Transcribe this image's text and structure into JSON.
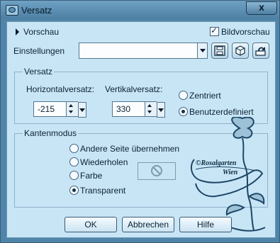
{
  "window": {
    "title": "Versatz",
    "close_glyph": "x"
  },
  "preview": {
    "label": "Vorschau",
    "image_preview_label": "Bildvorschau",
    "image_preview_checked": true
  },
  "settings": {
    "label": "Einstellungen",
    "value": ""
  },
  "offset_group": {
    "title": "Versatz",
    "horizontal_label": "Horizontalversatz:",
    "horizontal_value": "-215",
    "vertical_label": "Vertikalversatz:",
    "vertical_value": "330",
    "options": [
      {
        "label": "Zentriert",
        "selected": false
      },
      {
        "label": "Benutzerdefiniert",
        "selected": true
      }
    ]
  },
  "edge_group": {
    "title": "Kantenmodus",
    "options": [
      {
        "label": "Andere Seite übernehmen",
        "selected": false
      },
      {
        "label": "Wiederholen",
        "selected": false
      },
      {
        "label": "Farbe",
        "selected": false
      },
      {
        "label": "Transparent",
        "selected": true
      }
    ]
  },
  "buttons": {
    "ok": "OK",
    "cancel": "Abbrechen",
    "help": "Hilfe"
  },
  "watermark": {
    "line1": "©Rosalgarten",
    "line2": "Wien"
  },
  "icons": [
    "app-icon",
    "close-icon",
    "expand-arrow-icon",
    "dropdown-arrow-icon",
    "save-icon",
    "reset-icon",
    "load-icon",
    "spin-up-icon",
    "spin-down-icon",
    "no-color-icon"
  ]
}
